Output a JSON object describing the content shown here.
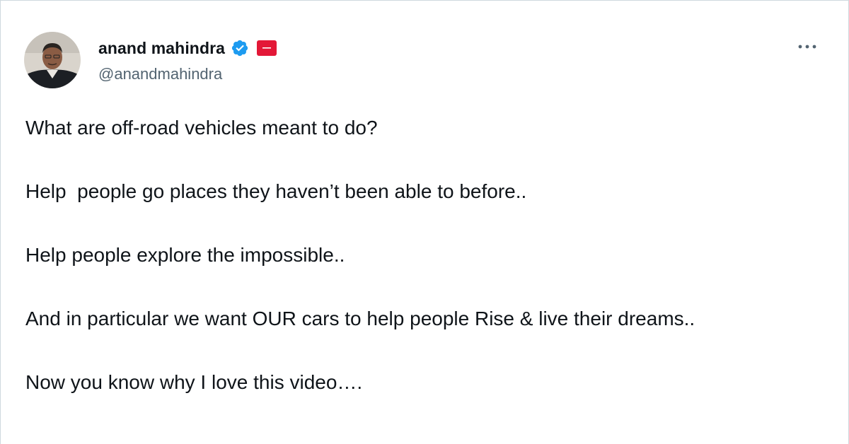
{
  "author": {
    "display_name": "anand mahindra",
    "handle": "@anandmahindra",
    "avatar_icon": "user-avatar-photo",
    "verified_icon": "verified-badge-icon",
    "verified_color": "#1d9bf0",
    "affiliate_icon": "mahindra-affiliate-badge-icon",
    "affiliate_color": "#e31837"
  },
  "actions": {
    "more_icon": "more-options-icon"
  },
  "tweet": {
    "paragraphs": [
      "What are off-road vehicles meant to do?",
      "Help  people go places they haven’t been able to before..",
      "Help people explore the impossible..",
      "And in particular we want OUR cars to help people Rise & live their dreams..",
      "Now you know why I love this video…."
    ]
  },
  "colors": {
    "text_primary": "#0f1419",
    "text_secondary": "#536471",
    "border": "#cfd9de"
  }
}
